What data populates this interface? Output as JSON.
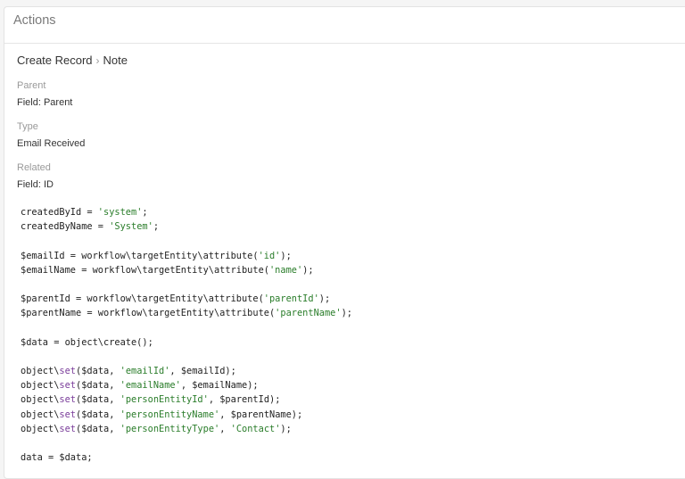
{
  "panel": {
    "title": "Actions"
  },
  "breadcrumb": {
    "action": "Create Record",
    "separator": "›",
    "entity": "Note"
  },
  "fields": [
    {
      "label": "Parent",
      "value": "Field: Parent"
    },
    {
      "label": "Type",
      "value": "Email Received"
    },
    {
      "label": "Related",
      "value": "Field: ID"
    }
  ],
  "code_lines": [
    [
      {
        "t": "createdById = "
      },
      {
        "t": "'system'",
        "c": "str"
      },
      {
        "t": ";"
      }
    ],
    [
      {
        "t": "createdByName = "
      },
      {
        "t": "'System'",
        "c": "str"
      },
      {
        "t": ";"
      }
    ],
    [],
    [
      {
        "t": "$emailId = workflow\\targetEntity\\attribute("
      },
      {
        "t": "'id'",
        "c": "str"
      },
      {
        "t": ");"
      }
    ],
    [
      {
        "t": "$emailName = workflow\\targetEntity\\attribute("
      },
      {
        "t": "'name'",
        "c": "str"
      },
      {
        "t": ");"
      }
    ],
    [],
    [
      {
        "t": "$parentId = workflow\\targetEntity\\attribute("
      },
      {
        "t": "'parentId'",
        "c": "str"
      },
      {
        "t": ");"
      }
    ],
    [
      {
        "t": "$parentName = workflow\\targetEntity\\attribute("
      },
      {
        "t": "'parentName'",
        "c": "str"
      },
      {
        "t": ");"
      }
    ],
    [],
    [
      {
        "t": "$data = object\\create();"
      }
    ],
    [],
    [
      {
        "t": "object\\"
      },
      {
        "t": "set",
        "c": "kw"
      },
      {
        "t": "($data, "
      },
      {
        "t": "'emailId'",
        "c": "str"
      },
      {
        "t": ", $emailId);"
      }
    ],
    [
      {
        "t": "object\\"
      },
      {
        "t": "set",
        "c": "kw"
      },
      {
        "t": "($data, "
      },
      {
        "t": "'emailName'",
        "c": "str"
      },
      {
        "t": ", $emailName);"
      }
    ],
    [
      {
        "t": "object\\"
      },
      {
        "t": "set",
        "c": "kw"
      },
      {
        "t": "($data, "
      },
      {
        "t": "'personEntityId'",
        "c": "str"
      },
      {
        "t": ", $parentId);"
      }
    ],
    [
      {
        "t": "object\\"
      },
      {
        "t": "set",
        "c": "kw"
      },
      {
        "t": "($data, "
      },
      {
        "t": "'personEntityName'",
        "c": "str"
      },
      {
        "t": ", $parentName);"
      }
    ],
    [
      {
        "t": "object\\"
      },
      {
        "t": "set",
        "c": "kw"
      },
      {
        "t": "($data, "
      },
      {
        "t": "'personEntityType'",
        "c": "str"
      },
      {
        "t": ", "
      },
      {
        "t": "'Contact'",
        "c": "str"
      },
      {
        "t": ");"
      }
    ],
    [],
    [
      {
        "t": "data = $data;"
      }
    ]
  ]
}
